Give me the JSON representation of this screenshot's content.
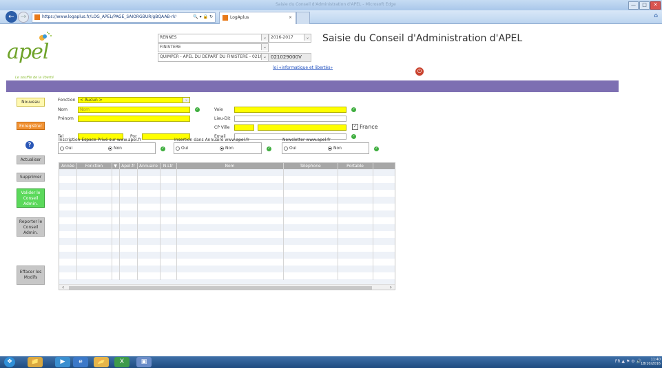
{
  "browser": {
    "url": "https://www.logaplus.fr/LOG_APEL/PAGE_SAIORGBUR/gBQAAB-rkVIRUFSTUNSQ3R-",
    "tab_title": "LogAplus",
    "tab_close": "×",
    "window_title_faint": "Saisie du Conseil d'Administration d'APEL - Microsoft Edge",
    "controls": [
      "—",
      "□",
      "✕"
    ]
  },
  "logo": {
    "word": "apel",
    "tagline": "Le souffle de la liberté"
  },
  "header": {
    "ville": "RENNES",
    "annee": "2016-2017",
    "departement": "FINISTERE",
    "etablissement": "QUIMPER - APEL DU DEPART DU FINISTERE - 0210",
    "code": "021029000V",
    "page_title": "Saisie du Conseil d'Administration d'APEL",
    "info_link": "loi «informatique et libertés»"
  },
  "sidebar": {
    "nouveau": "Nouveau",
    "enregistrer": "Enregistrer",
    "help": "?",
    "actualiser": "Actualiser",
    "supprimer": "Supprimer",
    "valider": [
      "Valider le",
      "Conseil",
      "Admin."
    ],
    "reporter": [
      "Reporter le",
      "Conseil",
      "Admin."
    ],
    "effacer": [
      "Effacer les",
      "Modifs"
    ]
  },
  "form": {
    "fonction_label": "Fonction",
    "fonction_value": "< Aucun >",
    "nom_label": "Nom",
    "nom_placeholder": "Nom",
    "prenom_label": "Prénom",
    "tel_label": "Tel",
    "por_label": "Por",
    "voie_label": "Voie",
    "lieudit_label": "Lieu-Dit",
    "cpville_label": "CP Ville",
    "email_label": "Email",
    "france_label": "France",
    "france_checked": true,
    "groups": [
      {
        "title": "Inscription Espace Privé sur www.apel.fr",
        "oui": "Oui",
        "non": "Non",
        "selected": "Non"
      },
      {
        "title": "Insertion dans Annuaire www.apel.fr",
        "oui": "Oui",
        "non": "Non",
        "selected": "Non"
      },
      {
        "title": "Newsletter www.apel.fr",
        "oui": "Oui",
        "non": "Non",
        "selected": "Non"
      }
    ]
  },
  "grid": {
    "columns": [
      "Année",
      "Fonction",
      "▼",
      "Apel.fr",
      "Annuaire",
      "N.Ltr",
      "Nom",
      "Téléphone",
      "Portable",
      ""
    ],
    "rows": []
  },
  "taskbar": {
    "lang": "FR",
    "time": "11:40",
    "date": "18/10/2016"
  },
  "colors": {
    "purple_band": "#7d6fb2",
    "required_field": "#ffff00",
    "save_button": "#f19233",
    "validate_button": "#5bd95b",
    "apel_green": "#6fa32a"
  }
}
